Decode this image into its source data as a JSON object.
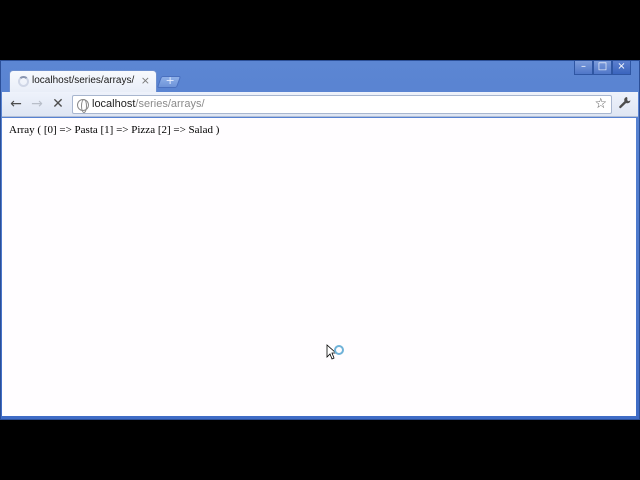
{
  "tab": {
    "title": "localhost/series/arrays/",
    "close_glyph": "×",
    "new_tab_glyph": "+"
  },
  "window_controls": {
    "minimize": "–",
    "maximize": "□",
    "close": "×"
  },
  "toolbar": {
    "back_glyph": "←",
    "forward_glyph": "→",
    "stop_glyph": "✕",
    "star_glyph": "☆",
    "wrench_glyph": "🔧"
  },
  "omnibox": {
    "host": "localhost",
    "path": "/series/arrays/"
  },
  "page": {
    "text": "Array ( [0] => Pasta [1] => Pizza [2] => Salad )"
  }
}
